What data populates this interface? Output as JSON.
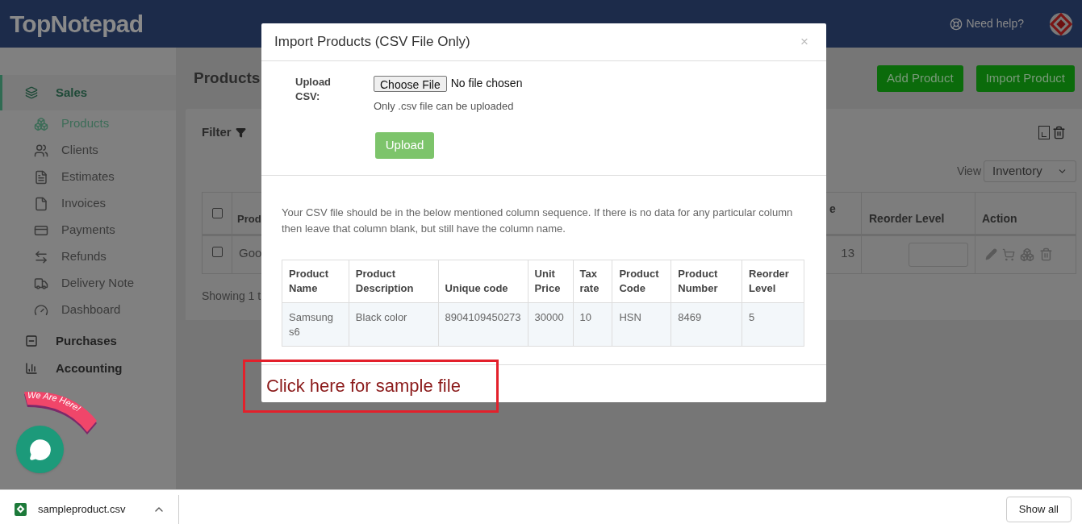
{
  "header": {
    "logo": "TopNotepad",
    "help": "Need help?"
  },
  "sidebar": {
    "sections": [
      {
        "label": "Sales",
        "selected": true,
        "items": [
          {
            "label": "Products",
            "selected": true
          },
          {
            "label": "Clients",
            "selected": false
          },
          {
            "label": "Estimates",
            "selected": false
          },
          {
            "label": "Invoices",
            "selected": false
          },
          {
            "label": "Payments",
            "selected": false
          },
          {
            "label": "Refunds",
            "selected": false
          },
          {
            "label": "Delivery Note",
            "selected": false
          },
          {
            "label": "Dashboard",
            "selected": false
          }
        ]
      },
      {
        "label": "Purchases",
        "selected": false
      },
      {
        "label": "Accounting",
        "selected": false
      }
    ]
  },
  "page": {
    "title": "Products",
    "buttons": [
      "Add Product",
      "Import Product"
    ],
    "filter": "Filter",
    "view_label": "View",
    "view_value": "Inventory",
    "table": {
      "columns": [
        "Prod",
        "e",
        "Reorder Level",
        "Action"
      ],
      "rows": [
        {
          "checked": false,
          "cells": [
            "Goo",
            "13"
          ]
        }
      ],
      "header_checked": false
    },
    "showing": "Showing 1 t"
  },
  "chat": {
    "badge": "We Are Here!"
  },
  "modal": {
    "title": "Import Products (CSV File Only)",
    "close": "×",
    "upload_label": "Upload CSV:",
    "choose_button": "Choose File",
    "file_status": "No file chosen",
    "hint": "Only .csv file can be uploaded",
    "upload_button": "Upload",
    "note": "Your CSV file should be in the below mentioned column sequence. If there is no data for any particular column then leave that column blank, but still have the column name.",
    "sample_table": {
      "columns": [
        "Product Name",
        "Product Description",
        "Unique code",
        "Unit Price",
        "Tax rate",
        "Product Code",
        "Product Number",
        "Reorder Level"
      ],
      "rows": [
        [
          "Samsung s6",
          "Black color",
          "8904109450273",
          "30000",
          "10",
          "HSN",
          "8469",
          "5"
        ]
      ]
    },
    "sample_link": "Click here for sample file"
  },
  "download_bar": {
    "file": "sampleproduct.csv",
    "show_all": "Show all"
  }
}
